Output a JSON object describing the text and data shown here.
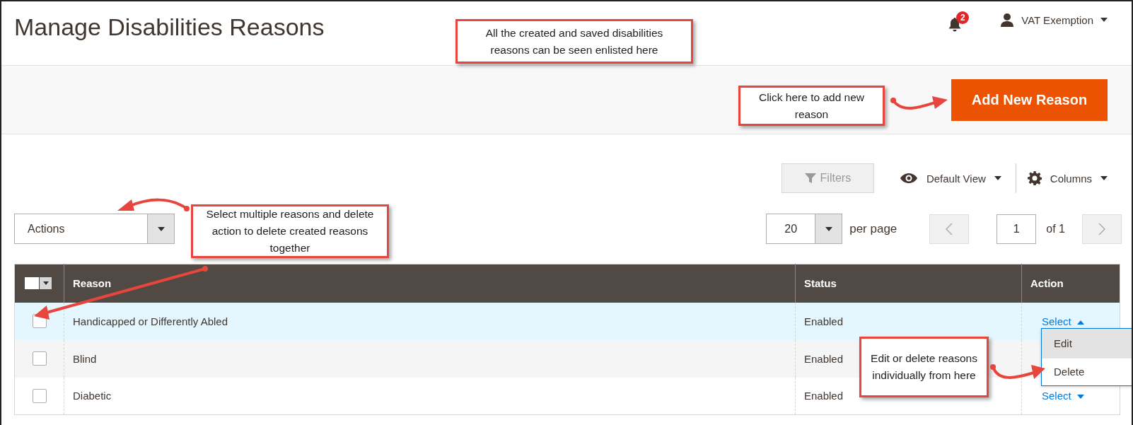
{
  "page_title": "Manage Disabilities Reasons",
  "header": {
    "notification_count": "2",
    "user_name": "VAT Exemption"
  },
  "add_button": "Add New Reason",
  "toolbar": {
    "filters": "Filters",
    "view": "Default View",
    "columns": "Columns"
  },
  "mass_actions": {
    "value": "Actions"
  },
  "pager": {
    "page_size": "20",
    "per_page_label": "per page",
    "page": "1",
    "total": "of 1"
  },
  "table": {
    "select_all": {
      "checked": false
    },
    "columns": [
      "Reason",
      "Status",
      "Action"
    ],
    "rows": [
      {
        "reason": "Handicapped or Differently Abled",
        "status": "Enabled",
        "action": "Select",
        "checked": false,
        "hovered": true,
        "menu_open": true
      },
      {
        "reason": "Blind",
        "status": "Enabled",
        "checked": false,
        "hovered": false
      },
      {
        "reason": "Diabetic",
        "status": "Enabled",
        "action": "Select",
        "checked": false,
        "hovered": false,
        "menu_open": false
      }
    ]
  },
  "action_menu": [
    {
      "label": "Edit",
      "selected": true
    },
    {
      "label": "Delete",
      "selected": false
    }
  ],
  "callouts": [
    {
      "text": "All the created and saved disabilities reasons can be seen enlisted here"
    },
    {
      "text": "Click here to add new reason"
    },
    {
      "text": "Select multiple reasons and delete action to delete created reasons together"
    },
    {
      "text": "Edit or delete reasons individually from here"
    }
  ]
}
